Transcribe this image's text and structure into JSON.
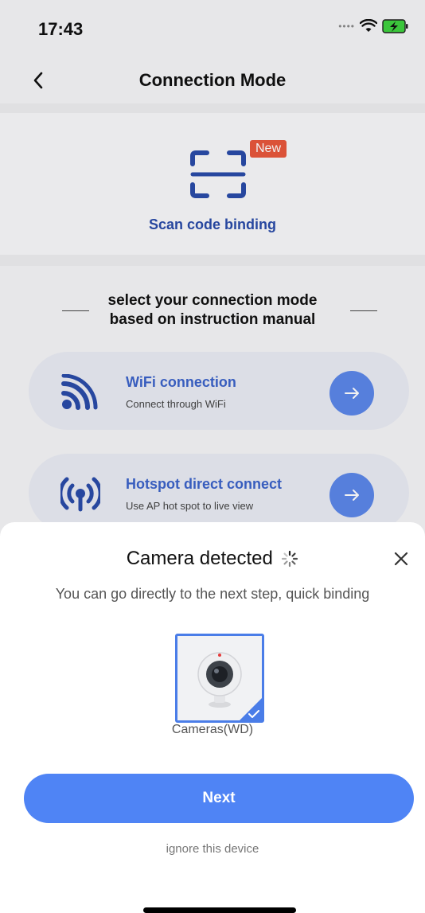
{
  "status_bar": {
    "time": "17:43",
    "icons": [
      "signal-dots-icon",
      "wifi-icon",
      "battery-charging-icon"
    ]
  },
  "nav": {
    "title": "Connection Mode",
    "back_icon": "chevron-left-icon"
  },
  "scan": {
    "badge": "New",
    "label": "Scan code binding",
    "icon": "scan-frame-icon"
  },
  "instruction": {
    "line1": "select your connection mode",
    "line2": "based on instruction manual"
  },
  "modes": [
    {
      "title": "WiFi connection",
      "subtitle": "Connect through WiFi",
      "icon": "wifi-waves-icon"
    },
    {
      "title": "Hotspot direct connect",
      "subtitle": "Use AP hot spot to live view",
      "icon": "hotspot-icon"
    }
  ],
  "sheet": {
    "title": "Camera detected",
    "subtitle": "You can go directly to the next step, quick binding",
    "device_label": "Cameras(WD)",
    "next_label": "Next",
    "ignore_label": "ignore this device"
  },
  "colors": {
    "accent": "#4f84f5",
    "scan_label": "#2a4ba8",
    "mode_title": "#3b63c9",
    "badge": "#e7573c"
  }
}
